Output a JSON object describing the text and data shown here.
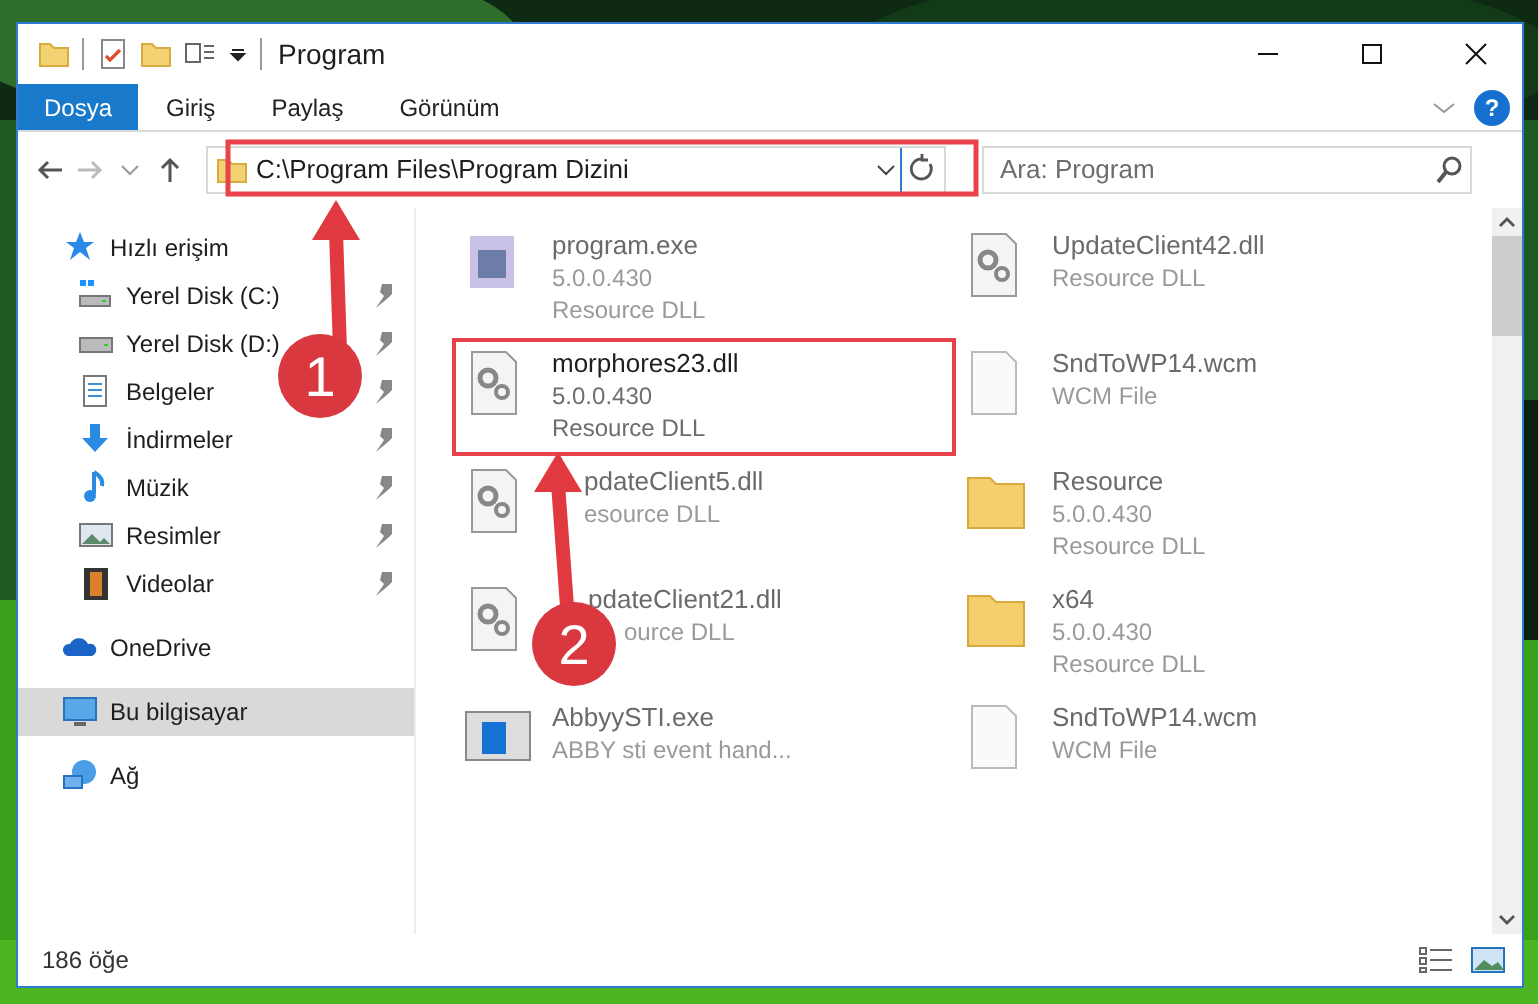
{
  "window": {
    "title": "Program"
  },
  "quick_toolbar": [
    {
      "kind": "folder"
    },
    {
      "kind": "properties"
    },
    {
      "kind": "newfolder"
    },
    {
      "kind": "views"
    }
  ],
  "ribbon_tabs": [
    {
      "label": "Dosya",
      "kind": "file"
    },
    {
      "label": "Giriş",
      "kind": "tab"
    },
    {
      "label": "Paylaş",
      "kind": "tab"
    },
    {
      "label": "Görünüm",
      "kind": "tab"
    }
  ],
  "help": {
    "label": "?"
  },
  "address": {
    "path": "C:\\Program Files\\Program Dizini"
  },
  "search": {
    "placeholder": "Ara: Program"
  },
  "sidebar": {
    "items": [
      {
        "label": "Hızlı erişim",
        "kind": "star",
        "selected": false,
        "children": [
          {
            "label": "Yerel Disk (C:)",
            "kind": "disk-c",
            "pinned": true,
            "selected": false
          },
          {
            "label": "Yerel Disk (D:)",
            "kind": "disk",
            "pinned": true,
            "selected": false
          },
          {
            "label": "Belgeler",
            "kind": "docs",
            "pinned": true,
            "selected": false
          },
          {
            "label": "İndirmeler",
            "kind": "download",
            "pinned": true,
            "selected": false
          },
          {
            "label": "Müzik",
            "kind": "music",
            "pinned": true,
            "selected": false
          },
          {
            "label": "Resimler",
            "kind": "pictures",
            "pinned": true,
            "selected": false
          },
          {
            "label": "Videolar",
            "kind": "videos",
            "pinned": true,
            "selected": false
          }
        ]
      },
      {
        "label": "OneDrive",
        "kind": "cloud",
        "selected": false
      },
      {
        "label": "Bu bilgisayar",
        "kind": "pc",
        "selected": true
      },
      {
        "label": "Ağ",
        "kind": "network",
        "selected": false
      }
    ]
  },
  "files": [
    {
      "name": "program.exe",
      "lines": [
        "5.0.0.430",
        "Resource DLL"
      ],
      "kind": "exe",
      "highlighted": false
    },
    {
      "name": "UpdateClient42.dll",
      "lines": [
        "Resource DLL"
      ],
      "kind": "dll",
      "highlighted": false
    },
    {
      "name": "morphores23.dll",
      "lines": [
        "5.0.0.430",
        "Resource DLL"
      ],
      "kind": "dll",
      "highlighted": true
    },
    {
      "name": "SndToWP14.wcm",
      "lines": [
        "WCM File"
      ],
      "kind": "file",
      "highlighted": false
    },
    {
      "name": "pdateClient5.dll",
      "lines": [
        "esource DLL"
      ],
      "kind": "dll",
      "highlighted": false
    },
    {
      "name": "Resource",
      "lines": [
        "5.0.0.430",
        "Resource DLL"
      ],
      "kind": "folder",
      "highlighted": false
    },
    {
      "name": "pdateClient21.dll",
      "lines": [
        "ource DLL"
      ],
      "kind": "dll",
      "highlighted": false
    },
    {
      "name": "x64",
      "lines": [
        "5.0.0.430",
        "Resource DLL"
      ],
      "kind": "folder",
      "highlighted": false
    },
    {
      "name": "AbbyySTI.exe",
      "lines": [
        "ABBY sti event hand..."
      ],
      "kind": "app",
      "highlighted": false
    },
    {
      "name": "SndToWP14.wcm",
      "lines": [
        "WCM File"
      ],
      "kind": "file",
      "highlighted": false
    }
  ],
  "status_bar": {
    "count": "186 öğe"
  },
  "callouts": [
    {
      "label": "1"
    },
    {
      "label": "2"
    }
  ]
}
